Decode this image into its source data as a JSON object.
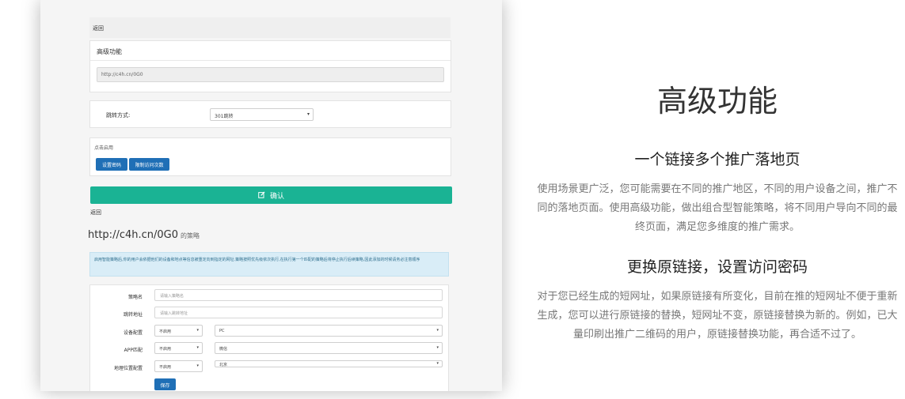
{
  "screenshot": {
    "back_label": "返回",
    "advanced_panel_title": "高级功能",
    "short_url": "http://c4h.cn/0G0",
    "redirect_label": "跳转方式:",
    "redirect_value": "301跳转",
    "enable_label": "点击启用",
    "set_password_button": "设置密码",
    "limit_visits_button": "限制访问次数",
    "confirm_button": "确认",
    "back_label_2": "返回",
    "strategy_url": "http://c4h.cn/0G0",
    "strategy_suffix": "的策略",
    "info_text": "启用智能策略后,你的用户会依据他们的设备和地点等信息被重定向到指定的网址.策略按照优先级依次执行,在执行第一个匹配的策略后将停止执行后续策略,因此添加的时候请务必注意顺序",
    "form": {
      "strategy_name_label": "策略名",
      "strategy_name_placeholder": "请输入策略名",
      "target_url_label": "跳转地址",
      "target_url_placeholder": "请输入跳转地址",
      "device_label": "设备配置",
      "device_toggle": "不启用",
      "device_value": "PC",
      "app_label": "APP匹配",
      "app_toggle": "不启用",
      "app_value": "微信",
      "geo_label": "地理位置配置",
      "geo_toggle": "不启用",
      "geo_value": "北京",
      "save_button": "保存"
    }
  },
  "feature": {
    "title": "高级功能",
    "subtitle1": "一个链接多个推广落地页",
    "body1": "使用场景更广泛，您可能需要在不同的推广地区，不同的用户设备之间，推广不同的落地页面。使用高级功能，做出组合型智能策略，将不同用户导向不同的最终页面，满足您多维度的推广需求。",
    "subtitle2": "更换原链接，设置访问密码",
    "body2": "对于您已经生成的短网址，如果原链接有所变化，目前在推的短网址不便于重新生成，您可以进行原链接的替换，短网址不变，原链接替换为新的。例如，已大量印刷出推广二维码的用户，原链接替换功能，再合适不过了。"
  },
  "colors": {
    "confirm_green": "#1ab394",
    "button_blue": "#1f6fb6",
    "info_bg": "#d9edf7"
  },
  "icons": {
    "confirm_icon": "edit-icon",
    "select_caret": "chevron-down-icon"
  }
}
